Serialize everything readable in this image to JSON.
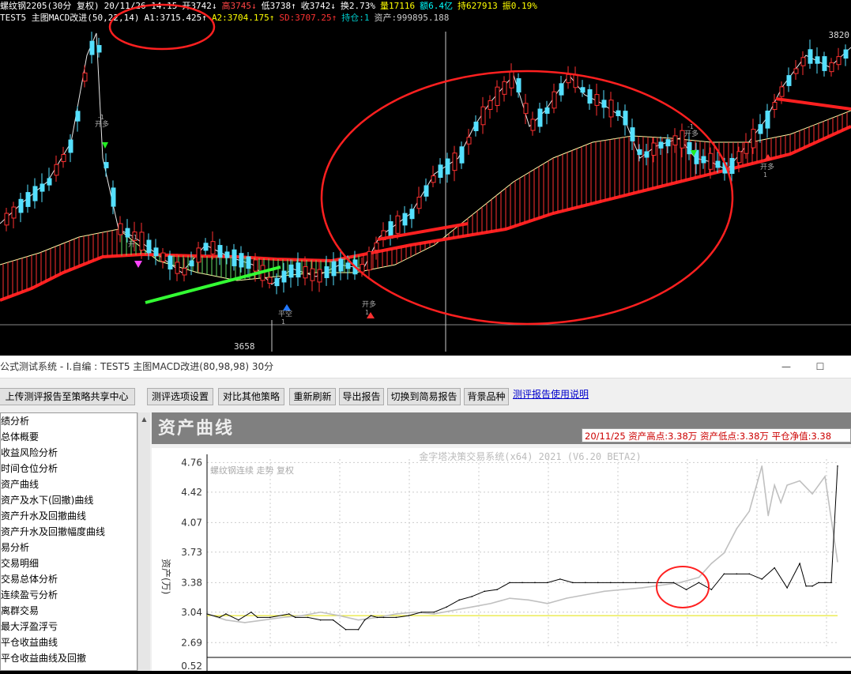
{
  "top_header": {
    "line1": [
      {
        "text": "螺纹钢2205(30分  复权)",
        "color": "#ffffff"
      },
      {
        "text": "20/11/26 14:15",
        "color": "#ffffff"
      },
      {
        "text": "开3742↓",
        "color": "#ffffff"
      },
      {
        "text": "高3745↓",
        "color": "#ff4444"
      },
      {
        "text": "低3738↑",
        "color": "#ffffff"
      },
      {
        "text": "收3742↓",
        "color": "#ffffff"
      },
      {
        "text": "换2.73%",
        "color": "#ffffff"
      },
      {
        "text": "量17116",
        "color": "#ffff00"
      },
      {
        "text": "额6.4亿",
        "color": "#00ffff"
      },
      {
        "text": "持627913",
        "color": "#ffff00"
      },
      {
        "text": "振0.19%",
        "color": "#ffff00"
      }
    ],
    "line2": [
      {
        "text": "TEST5 主图MACD改进(50,22,14)",
        "color": "#ffffff"
      },
      {
        "text": "A1:3715.425↑",
        "color": "#ffffff"
      },
      {
        "text": "A2:3704.175↑",
        "color": "#ffff00"
      },
      {
        "text": "SD:3707.25↑",
        "color": "#ff3333"
      },
      {
        "text": "持仓:1",
        "color": "#00cccc"
      },
      {
        "text": "资产:999895.188",
        "color": "#cccccc"
      }
    ],
    "price_high_label": "3820",
    "price_low_label": "3658",
    "signal_labels": [
      {
        "text": "开多",
        "sub": "-1",
        "color": "#aaaaaa"
      },
      {
        "text": "开",
        "sub": "-1",
        "color": "#aaaaaa"
      },
      {
        "text": "平空",
        "sub": "1",
        "color": "#aaaaaa"
      },
      {
        "text": "开多",
        "sub": "1",
        "color": "#aaaaaa"
      },
      {
        "text": "开多",
        "sub": "-1",
        "color": "#aaaaaa"
      },
      {
        "text": "开多",
        "sub": "1",
        "color": "#aaaaaa"
      }
    ]
  },
  "window": {
    "title": "公式测试系统 - I.自编 : TEST5 主图MACD改进(80,98,98) 30分",
    "minimize": "—",
    "maximize": "☐"
  },
  "toolbar": {
    "buttons": [
      "上传测评报告至策略共享中心",
      "测评选项设置",
      "对比其他策略",
      "重新刷新",
      "导出报告",
      "切换到简易报告",
      "背景品种"
    ],
    "help_link": "测评报告使用说明"
  },
  "sidebar": {
    "items": [
      "绩分析",
      "总体概要",
      "收益风险分析",
      "时间仓位分析",
      "资产曲线",
      "资产及水下(回撤)曲线",
      "资产升水及回撤曲线",
      "资产升水及回撤幅度曲线",
      "易分析",
      "交易明细",
      "交易总体分析",
      "连续盈亏分析",
      "离群交易",
      "最大浮盈浮亏",
      "平仓收益曲线",
      "平仓收益曲线及回撤"
    ]
  },
  "content": {
    "title": "资产曲线",
    "stats": "20/11/25 资产高点:3.38万  资产低点:3.38万  平仓净值:3.38"
  },
  "chart_data": {
    "type": "line",
    "title": "金字塔决策交易系统(x64) 2021 (V6.20 BETA2)",
    "subtitle": "螺纹钢连续 走势 复权",
    "ylabel": "资产(万)",
    "xlabel": "",
    "y_ticks": [
      "4.76",
      "4.42",
      "4.07",
      "3.73",
      "3.38",
      "3.04",
      "2.69",
      "0.52"
    ],
    "ylim": [
      2.62,
      4.8
    ],
    "grid": true,
    "reference_lines": [
      {
        "name": "",
        "value": 3.0,
        "color": "#e0e000"
      }
    ],
    "series": [
      {
        "name": "",
        "color": "#000000",
        "x": [
          0,
          2,
          3,
          5,
          7,
          8,
          10,
          13,
          14,
          16,
          18,
          20,
          22,
          24,
          25,
          26,
          27,
          28,
          30,
          32,
          34,
          36,
          38,
          40,
          42,
          44,
          46,
          48,
          50,
          52,
          54,
          56,
          58,
          60,
          62,
          64,
          66,
          68,
          70,
          72,
          74,
          76,
          78,
          80,
          82,
          84,
          86,
          88,
          90,
          92,
          94,
          95,
          96,
          97,
          98,
          99,
          100
        ],
        "y": [
          3.02,
          2.98,
          3.02,
          2.95,
          3.04,
          2.98,
          2.98,
          3.02,
          2.98,
          2.98,
          2.95,
          2.95,
          2.84,
          2.84,
          2.95,
          3.0,
          2.98,
          2.98,
          2.98,
          3.0,
          3.04,
          3.04,
          3.1,
          3.18,
          3.22,
          3.28,
          3.3,
          3.38,
          3.38,
          3.38,
          3.38,
          3.42,
          3.38,
          3.38,
          3.38,
          3.38,
          3.38,
          3.38,
          3.38,
          3.38,
          3.38,
          3.3,
          3.38,
          3.3,
          3.48,
          3.48,
          3.48,
          3.42,
          3.55,
          3.32,
          3.6,
          3.34,
          3.34,
          3.38,
          3.38,
          3.38,
          4.72
        ]
      },
      {
        "name": "",
        "color": "#c0c0c0",
        "x": [
          0,
          3,
          6,
          9,
          12,
          15,
          18,
          21,
          24,
          27,
          30,
          33,
          36,
          39,
          42,
          45,
          48,
          51,
          54,
          57,
          60,
          63,
          66,
          69,
          72,
          75,
          78,
          80,
          82,
          84,
          86,
          88,
          89,
          90,
          91,
          92,
          94,
          96,
          98,
          100
        ],
        "y": [
          3.02,
          2.95,
          2.92,
          2.95,
          2.98,
          3.0,
          3.04,
          3.0,
          2.95,
          2.98,
          3.02,
          3.04,
          3.02,
          3.06,
          3.1,
          3.14,
          3.2,
          3.18,
          3.14,
          3.2,
          3.24,
          3.28,
          3.3,
          3.32,
          3.35,
          3.38,
          3.44,
          3.6,
          3.72,
          4.0,
          4.2,
          4.72,
          4.15,
          4.5,
          4.3,
          4.5,
          4.55,
          4.4,
          4.6,
          3.62
        ]
      }
    ]
  }
}
